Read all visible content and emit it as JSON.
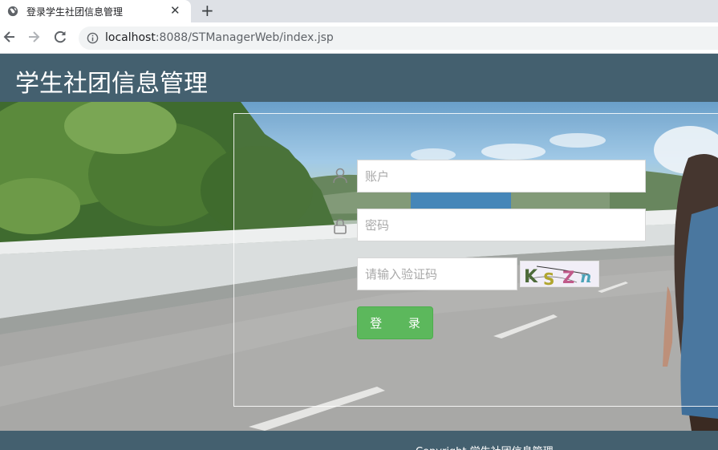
{
  "browser": {
    "tab_title": "登录学生社团信息管理",
    "close_glyph": "✕",
    "new_tab_glyph": "+",
    "url_host": "localhost",
    "url_rest": ":8088/STManagerWeb/index.jsp"
  },
  "header": {
    "site_title": "学生社团信息管理"
  },
  "login": {
    "account_placeholder": "账户",
    "password_placeholder": "密码",
    "captcha_placeholder": "请输入验证码",
    "captcha_text": "KSZn",
    "login_label": "登 录"
  },
  "footer": {
    "copyright": "Copyright  学生社团信息管理"
  },
  "colors": {
    "header_bg": "#44606f",
    "button_green": "#5cb85c"
  },
  "icons": [
    "globe-icon",
    "close-icon",
    "plus-icon",
    "back-icon",
    "forward-icon",
    "reload-icon",
    "info-icon",
    "user-icon",
    "lock-icon"
  ]
}
